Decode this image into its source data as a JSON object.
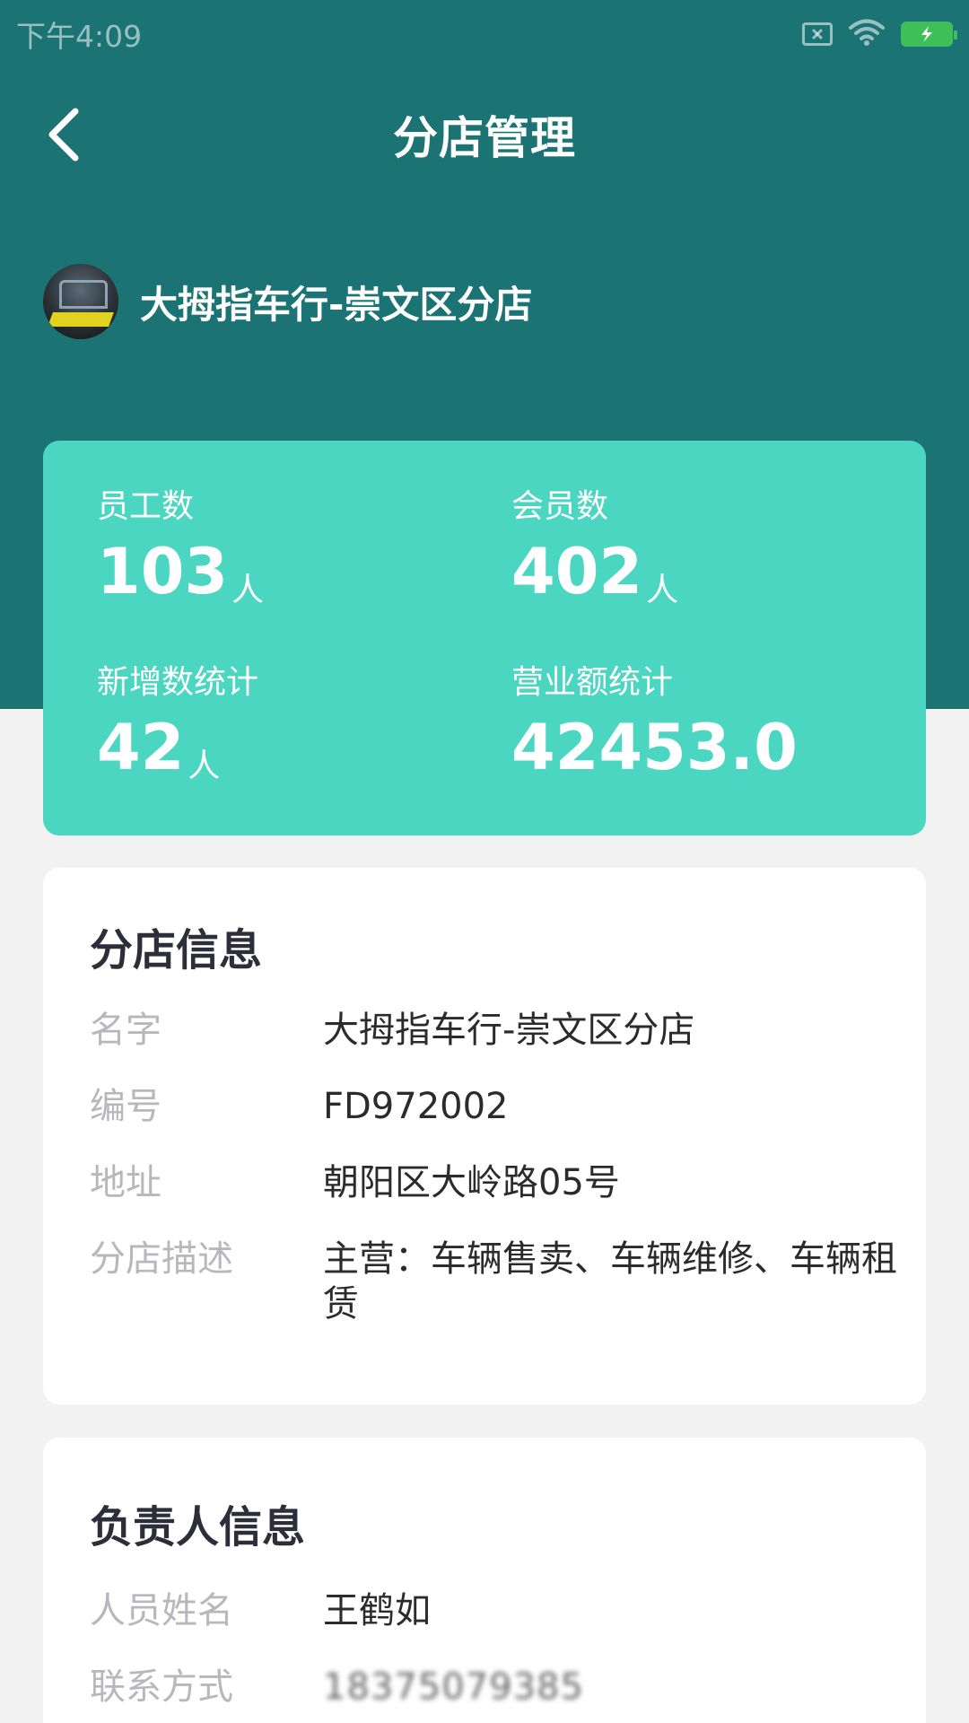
{
  "status_bar": {
    "time": "下午4:09",
    "icons": [
      "sim-error-icon",
      "wifi-icon",
      "battery-charging-icon"
    ],
    "battery_color": "#3fbf5a"
  },
  "header": {
    "title": "分店管理",
    "back_icon": "chevron-left-icon",
    "background_color": "#1b7373"
  },
  "store": {
    "name": "大拇指车行-崇文区分店"
  },
  "stats": {
    "card_color": "#4bd6c2",
    "items": [
      {
        "label": "员工数",
        "value": "103",
        "unit": "人"
      },
      {
        "label": "会员数",
        "value": "402",
        "unit": "人"
      },
      {
        "label": "新增数统计",
        "value": "42",
        "unit": "人"
      },
      {
        "label": "营业额统计",
        "value": "42453.0",
        "unit": ""
      }
    ]
  },
  "branch_info": {
    "title": "分店信息",
    "rows": [
      {
        "label": "名字",
        "value": "大拇指车行-崇文区分店"
      },
      {
        "label": "编号",
        "value": "FD972002"
      },
      {
        "label": "地址",
        "value": "朝阳区大岭路05号"
      },
      {
        "label": "分店描述",
        "value": "主营：车辆售卖、车辆维修、车辆租赁"
      }
    ]
  },
  "manager_info": {
    "title": "负责人信息",
    "rows": [
      {
        "label": "人员姓名",
        "value": "王鹤如"
      },
      {
        "label": "联系方式",
        "value": "18375079385"
      }
    ]
  }
}
